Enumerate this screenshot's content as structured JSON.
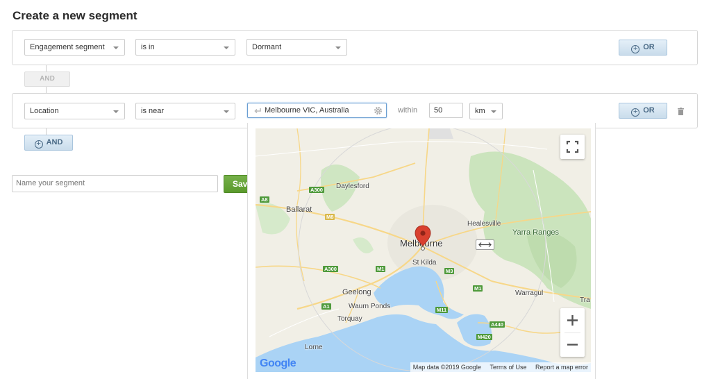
{
  "page": {
    "title": "Create a new segment"
  },
  "condition1": {
    "field": "Engagement segment",
    "operator": "is in",
    "value": "Dormant",
    "or_label": "OR"
  },
  "and_disabled_label": "AND",
  "condition2": {
    "field": "Location",
    "operator": "is near",
    "location_value": "Melbourne VIC, Australia",
    "within_label": "within",
    "distance_value": "50",
    "unit": "km",
    "or_label": "OR"
  },
  "and_button_label": "AND",
  "name_field": {
    "placeholder": "Name your segment"
  },
  "save_label": "Save",
  "map": {
    "labels": {
      "daylesford": "Daylesford",
      "ballarat": "Ballarat",
      "healesville": "Healesville",
      "yarra": "Yarra Ranges",
      "melbourne": "Melbourne",
      "stkilda": "St Kilda",
      "geelong": "Geelong",
      "waurn": "Waurn Ponds",
      "torquay": "Torquay",
      "warragul": "Warragul",
      "lorne": "Lorne",
      "tra": "Tra"
    },
    "shields": {
      "a300a": "A300",
      "a8": "A8",
      "m8": "M8",
      "a300b": "A300",
      "m1a": "M1",
      "m3": "M3",
      "m1b": "M1",
      "a1": "A1",
      "m11": "M11",
      "a440": "A440",
      "m420": "M420"
    },
    "footer": {
      "data": "Map data ©2019 Google",
      "terms": "Terms of Use",
      "report": "Report a map error"
    },
    "logo": "Google"
  },
  "colors": {
    "accent_blue": "#4a6a86",
    "save_green": "#5a9a2c",
    "water": "#aad3f5",
    "pin": "#d9412f"
  }
}
